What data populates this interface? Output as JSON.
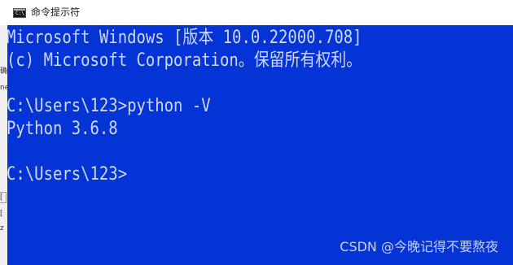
{
  "window": {
    "title": "命令提示符",
    "icon": "cmd-icon",
    "icon_text": "C:\\"
  },
  "left_fragments": [
    "确",
    "ne",
    "[",
    "[",
    "z"
  ],
  "console": {
    "background": "#0434d6",
    "foreground": "#cfd8ff",
    "lines": [
      "Microsoft Windows [版本 10.0.22000.708]",
      "(c) Microsoft Corporation。保留所有权利。",
      "",
      "C:\\Users\\123>python -V",
      "Python 3.6.8",
      "",
      "C:\\Users\\123>"
    ]
  },
  "watermark": "CSDN @今晚记得不要熬夜"
}
